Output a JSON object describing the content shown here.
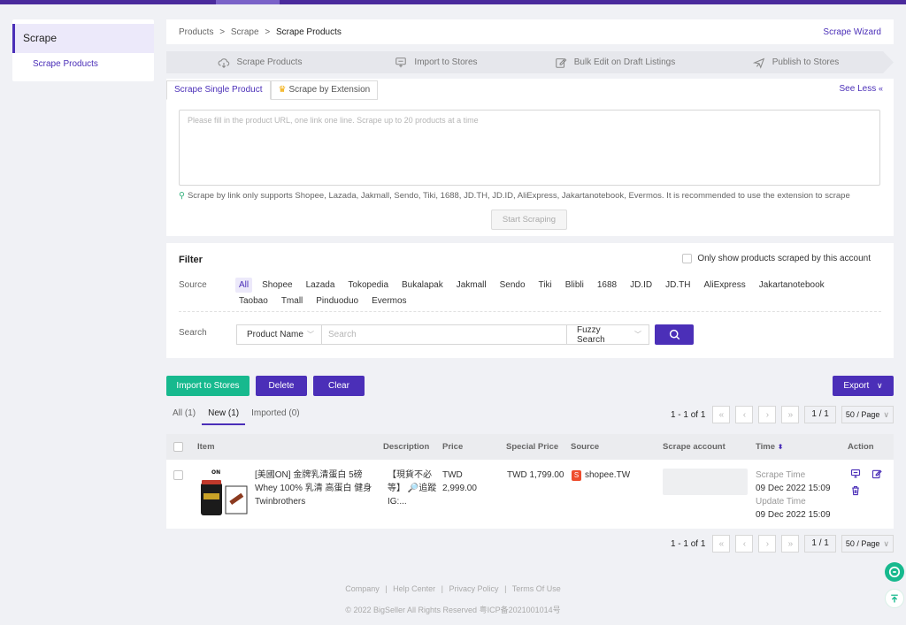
{
  "colors": {
    "brand": "#4b2fb8",
    "green": "#17b98e",
    "shopee": "#ee4d2d"
  },
  "sidebar": {
    "group": "Scrape",
    "item": "Scrape Products"
  },
  "breadcrumb": {
    "items": [
      "Products",
      ">",
      "Scrape",
      ">",
      "Scrape Products"
    ],
    "wizard": "Scrape Wizard"
  },
  "steps": [
    "Scrape Products",
    "Import to Stores",
    "Bulk Edit on Draft Listings",
    "Publish to Stores"
  ],
  "scrape": {
    "tabs": [
      "Scrape Single Product",
      "Scrape by Extension"
    ],
    "see_less": "See Less",
    "url_placeholder": "Please fill in the product URL, one link one line. Scrape up to 20 products at a time",
    "hint": "Scrape by link only supports Shopee, Lazada, Jakmall, Sendo, Tiki, 1688, JD.TH, JD.ID, AliExpress, Jakartanotebook, Evermos. It is recommended to use the extension to scrape",
    "start_button": "Start Scraping"
  },
  "filter": {
    "title": "Filter",
    "only_mine": "Only show products scraped by this account",
    "source_label": "Source",
    "sources": [
      "All",
      "Shopee",
      "Lazada",
      "Tokopedia",
      "Bukalapak",
      "Jakmall",
      "Sendo",
      "Tiki",
      "Blibli",
      "1688",
      "JD.ID",
      "JD.TH",
      "AliExpress",
      "Jakartanotebook",
      "Taobao",
      "Tmall",
      "Pinduoduo",
      "Evermos"
    ],
    "search_label": "Search",
    "search_field": "Product Name",
    "search_placeholder": "Search",
    "search_mode": "Fuzzy Search"
  },
  "actions": {
    "import": "Import to Stores",
    "delete": "Delete",
    "clear": "Clear",
    "export": "Export"
  },
  "subtabs": [
    "All (1)",
    "New (1)",
    "Imported (0)"
  ],
  "pagination": {
    "info": "1 - 1 of 1",
    "page": "1 / 1",
    "page_size": "50 / Page"
  },
  "table": {
    "headers": [
      "Item",
      "Description",
      "Price",
      "Special Price",
      "Source",
      "Scrape account",
      "Time",
      "Action"
    ],
    "rows": [
      {
        "item": "[美國ON] 金牌乳清蛋白 5磅 Whey 100% 乳清 高蛋白 健身 Twinbrothers",
        "description": "【現貨不必等】 🔎追蹤IG:...",
        "price_currency": "TWD",
        "price": "2,999.00",
        "special_price": "TWD 1,799.00",
        "source": "shopee.TW",
        "scrape_time_label": "Scrape Time",
        "scrape_time": "09 Dec 2022 15:09",
        "update_time_label": "Update Time",
        "update_time": "09 Dec 2022 15:09"
      }
    ]
  },
  "footer": {
    "links": [
      "Company",
      "|",
      "Help Center",
      "|",
      "Privacy Policy",
      "|",
      "Terms Of Use"
    ],
    "copyright": "© 2022 BigSeller All Rights Reserved   粤ICP备2021001014号"
  }
}
